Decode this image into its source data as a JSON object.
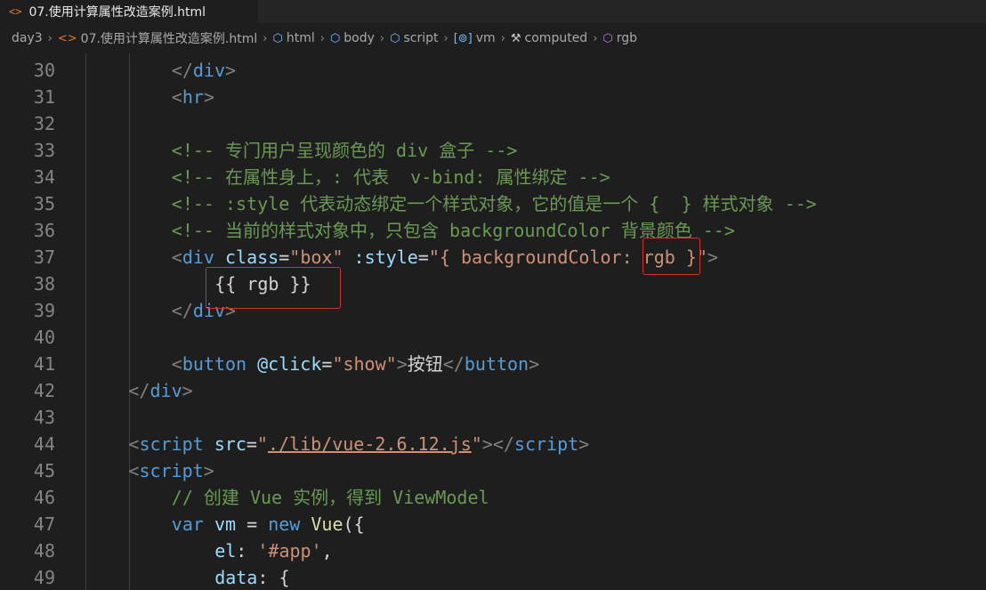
{
  "tab": {
    "icon": "<>",
    "title": "07.使用计算属性改造案例.html"
  },
  "breadcrumb": [
    {
      "label": "day3",
      "icon": ""
    },
    {
      "label": "07.使用计算属性改造案例.html",
      "icon": "<>"
    },
    {
      "label": "html",
      "icon": "⬡"
    },
    {
      "label": "body",
      "icon": "⬡"
    },
    {
      "label": "script",
      "icon": "⬡"
    },
    {
      "label": "vm",
      "icon": "[⊚]"
    },
    {
      "label": "computed",
      "icon": "🔧"
    },
    {
      "label": "rgb",
      "icon": "⬡"
    }
  ],
  "code_lines": [
    {
      "n": "30",
      "indent": 8,
      "tokens": [
        [
          "bracket",
          "</"
        ],
        [
          "tag",
          "div"
        ],
        [
          "bracket",
          ">"
        ]
      ]
    },
    {
      "n": "31",
      "indent": 8,
      "tokens": [
        [
          "bracket",
          "<"
        ],
        [
          "tag",
          "hr"
        ],
        [
          "bracket",
          ">"
        ]
      ]
    },
    {
      "n": "32",
      "indent": 0,
      "tokens": []
    },
    {
      "n": "33",
      "indent": 8,
      "tokens": [
        [
          "cmt",
          "<!-- 专门用户呈现颜色的 div 盒子 -->"
        ]
      ]
    },
    {
      "n": "34",
      "indent": 8,
      "tokens": [
        [
          "cmt",
          "<!-- 在属性身上，: 代表  v-bind: 属性绑定 -->"
        ]
      ]
    },
    {
      "n": "35",
      "indent": 8,
      "tokens": [
        [
          "cmt",
          "<!-- :style 代表动态绑定一个样式对象，它的值是一个 {  } 样式对象 -->"
        ]
      ]
    },
    {
      "n": "36",
      "indent": 8,
      "tokens": [
        [
          "cmt",
          "<!-- 当前的样式对象中，只包含 backgroundColor 背景颜色 -->"
        ]
      ]
    },
    {
      "n": "37",
      "indent": 8,
      "tokens": [
        [
          "bracket",
          "<"
        ],
        [
          "tag",
          "div"
        ],
        [
          "plain",
          " "
        ],
        [
          "attr",
          "class"
        ],
        [
          "plain",
          "="
        ],
        [
          "str",
          "\"box\""
        ],
        [
          "plain",
          " "
        ],
        [
          "attr",
          ":style"
        ],
        [
          "plain",
          "="
        ],
        [
          "str",
          "\"{ backgroundColor: rgb }\""
        ],
        [
          "bracket",
          ">"
        ]
      ]
    },
    {
      "n": "38",
      "indent": 12,
      "tokens": [
        [
          "plain",
          "{{ rgb }}"
        ]
      ]
    },
    {
      "n": "39",
      "indent": 8,
      "tokens": [
        [
          "bracket",
          "</"
        ],
        [
          "tag",
          "div"
        ],
        [
          "bracket",
          ">"
        ]
      ]
    },
    {
      "n": "40",
      "indent": 0,
      "tokens": []
    },
    {
      "n": "41",
      "indent": 8,
      "tokens": [
        [
          "bracket",
          "<"
        ],
        [
          "tag",
          "button"
        ],
        [
          "plain",
          " "
        ],
        [
          "attr",
          "@click"
        ],
        [
          "plain",
          "="
        ],
        [
          "str",
          "\"show\""
        ],
        [
          "bracket",
          ">"
        ],
        [
          "plain",
          "按钮"
        ],
        [
          "bracket",
          "</"
        ],
        [
          "tag",
          "button"
        ],
        [
          "bracket",
          ">"
        ]
      ]
    },
    {
      "n": "42",
      "indent": 4,
      "tokens": [
        [
          "bracket",
          "</"
        ],
        [
          "tag",
          "div"
        ],
        [
          "bracket",
          ">"
        ]
      ]
    },
    {
      "n": "43",
      "indent": 0,
      "tokens": []
    },
    {
      "n": "44",
      "indent": 4,
      "tokens": [
        [
          "bracket",
          "<"
        ],
        [
          "tag",
          "script"
        ],
        [
          "plain",
          " "
        ],
        [
          "attr",
          "src"
        ],
        [
          "plain",
          "="
        ],
        [
          "str",
          "\""
        ],
        [
          "str ul",
          "./lib/vue-2.6.12.js"
        ],
        [
          "str",
          "\""
        ],
        [
          "bracket",
          "></"
        ],
        [
          "tag",
          "script"
        ],
        [
          "bracket",
          ">"
        ]
      ]
    },
    {
      "n": "45",
      "indent": 4,
      "tokens": [
        [
          "bracket",
          "<"
        ],
        [
          "tag",
          "script"
        ],
        [
          "bracket",
          ">"
        ]
      ]
    },
    {
      "n": "46",
      "indent": 8,
      "tokens": [
        [
          "cmt",
          "// 创建 Vue 实例，得到 ViewModel"
        ]
      ]
    },
    {
      "n": "47",
      "indent": 8,
      "tokens": [
        [
          "kw",
          "var"
        ],
        [
          "plain",
          " "
        ],
        [
          "var",
          "vm"
        ],
        [
          "plain",
          " = "
        ],
        [
          "kw",
          "new"
        ],
        [
          "plain",
          " "
        ],
        [
          "fn",
          "Vue"
        ],
        [
          "plain",
          "({"
        ]
      ]
    },
    {
      "n": "48",
      "indent": 12,
      "tokens": [
        [
          "var",
          "el"
        ],
        [
          "plain",
          ": "
        ],
        [
          "str",
          "'#app'"
        ],
        [
          "plain",
          ","
        ]
      ]
    },
    {
      "n": "49",
      "indent": 12,
      "tokens": [
        [
          "var",
          "data"
        ],
        [
          "plain",
          ": {"
        ]
      ]
    }
  ],
  "colors": {
    "background": "#1e1e1e",
    "line_number": "#858585",
    "highlight_box": "#d32f2f"
  }
}
